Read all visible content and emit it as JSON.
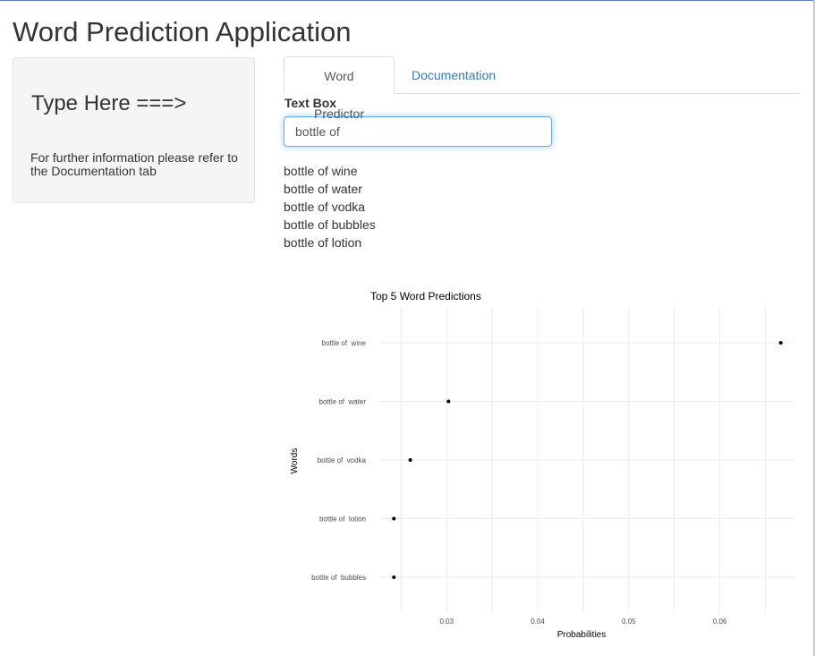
{
  "app": {
    "title": "Word Prediction Application"
  },
  "sidebar": {
    "heading": "Type Here ===>",
    "info": "For further information please refer to the Documentation tab"
  },
  "tabs": [
    {
      "label": "Word Predictor",
      "active": true
    },
    {
      "label": "Documentation",
      "active": false
    }
  ],
  "input": {
    "label": "Text Box",
    "value": "bottle of "
  },
  "predictions": [
    "bottle of wine",
    "bottle of water",
    "bottle of vodka",
    "bottle of bubbles",
    "bottle of lotion"
  ],
  "chart_data": {
    "type": "scatter",
    "title": "Top 5 Word Predictions",
    "xlabel": "Probabilities",
    "ylabel": "Words",
    "categories": [
      "bottle of  wine",
      "bottle of  water",
      "bottle of  vodka",
      "bottle of  lotion",
      "bottle of  bubbles"
    ],
    "values": [
      0.0667,
      0.0302,
      0.026,
      0.0242,
      0.0242
    ],
    "xticks": [
      0.03,
      0.04,
      0.05,
      0.06
    ],
    "xtick_labels": [
      "0.03",
      "0.04",
      "0.05",
      "0.06"
    ],
    "xlim": [
      0.0226,
      0.0682
    ],
    "grid": true,
    "point_color": "#000000"
  },
  "colors": {
    "link": "#337ab7",
    "input_focus_border": "#66afe9",
    "sidebar_bg": "#f5f5f5",
    "grid": "#ebebeb"
  }
}
